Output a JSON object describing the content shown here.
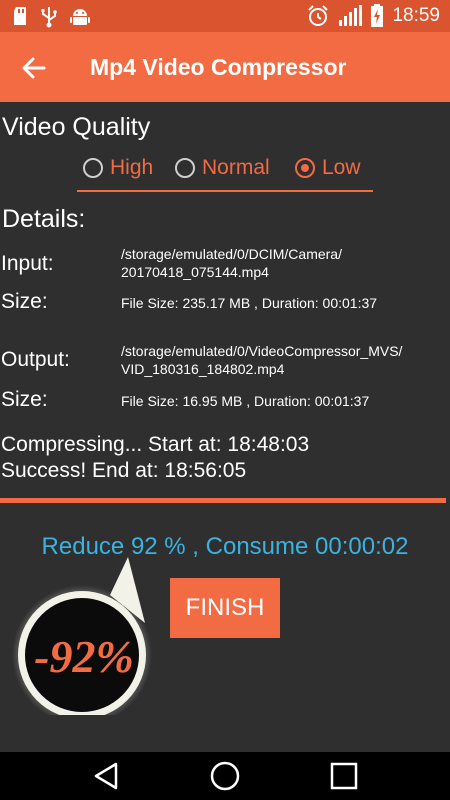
{
  "status_bar": {
    "time": "18:59",
    "left_icons": [
      "sd-card-icon",
      "usb-icon",
      "android-icon"
    ],
    "right_icons": [
      "alarm-icon",
      "signal-icon",
      "battery-charging-icon"
    ]
  },
  "app_bar": {
    "title": "Mp4 Video Compressor",
    "back_icon": "back-arrow-icon"
  },
  "quality": {
    "title": "Video Quality",
    "options": [
      "High",
      "Normal",
      "Low"
    ],
    "selected": "Low"
  },
  "details": {
    "title": "Details:",
    "input_label": "Input:",
    "input_path_line1": "/storage/emulated/0/DCIM/Camera/",
    "input_path_line2": "20170418_075144.mp4",
    "input_size_label": "Size:",
    "input_size": "File Size: 235.17 MB , Duration: 00:01:37",
    "output_label": "Output:",
    "output_path_line1": "/storage/emulated/0/VideoCompressor_MVS/",
    "output_path_line2": "VID_180316_184802.mp4",
    "output_size_label": "Size:",
    "output_size": "File Size: 16.95 MB , Duration: 00:01:37"
  },
  "log": {
    "start": "Compressing... Start at: 18:48:03",
    "end": "Success! End at: 18:56:05"
  },
  "progress": {
    "value": 1.0
  },
  "summary": "Reduce 92 % , Consume 00:00:02",
  "finish_label": "FINISH",
  "badge_text": "-92%",
  "colors": {
    "accent": "#f26b43",
    "status_bar": "#d9542f",
    "summary": "#3bb2e0",
    "background": "#2f2f2f"
  },
  "nav_bar": {
    "icons": [
      "back-triangle-icon",
      "home-circle-icon",
      "recents-square-icon"
    ]
  }
}
